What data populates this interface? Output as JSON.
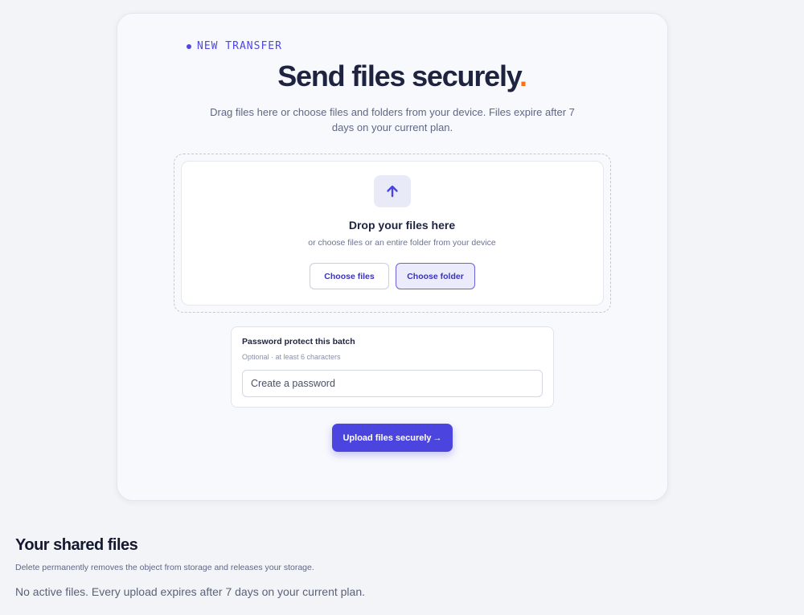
{
  "transfer": {
    "eyebrow": "NEW TRANSFER",
    "title": "Send files securely",
    "title_accent": ".",
    "subtitle": "Drag files here or choose files and folders from your device. Files expire after 7 days on your current plan."
  },
  "dropzone": {
    "icon": "arrow-up-icon",
    "title": "Drop your files here",
    "subtitle": "or choose files or an entire folder from your device",
    "choose_files_label": "Choose files",
    "choose_folder_label": "Choose folder"
  },
  "password": {
    "label": "Password protect this batch",
    "hint": "Optional · at least 6 characters",
    "placeholder": "Create a password",
    "value": ""
  },
  "upload": {
    "label": "Upload files securely",
    "arrow": "→"
  },
  "shared": {
    "title": "Your shared files",
    "description": "Delete permanently removes the object from storage and releases your storage.",
    "empty_message": "No active files. Every upload expires after 7 days on your current plan."
  },
  "colors": {
    "accent": "#4f46e5",
    "title_dot": "#f97316",
    "background": "#f3f4f7"
  }
}
